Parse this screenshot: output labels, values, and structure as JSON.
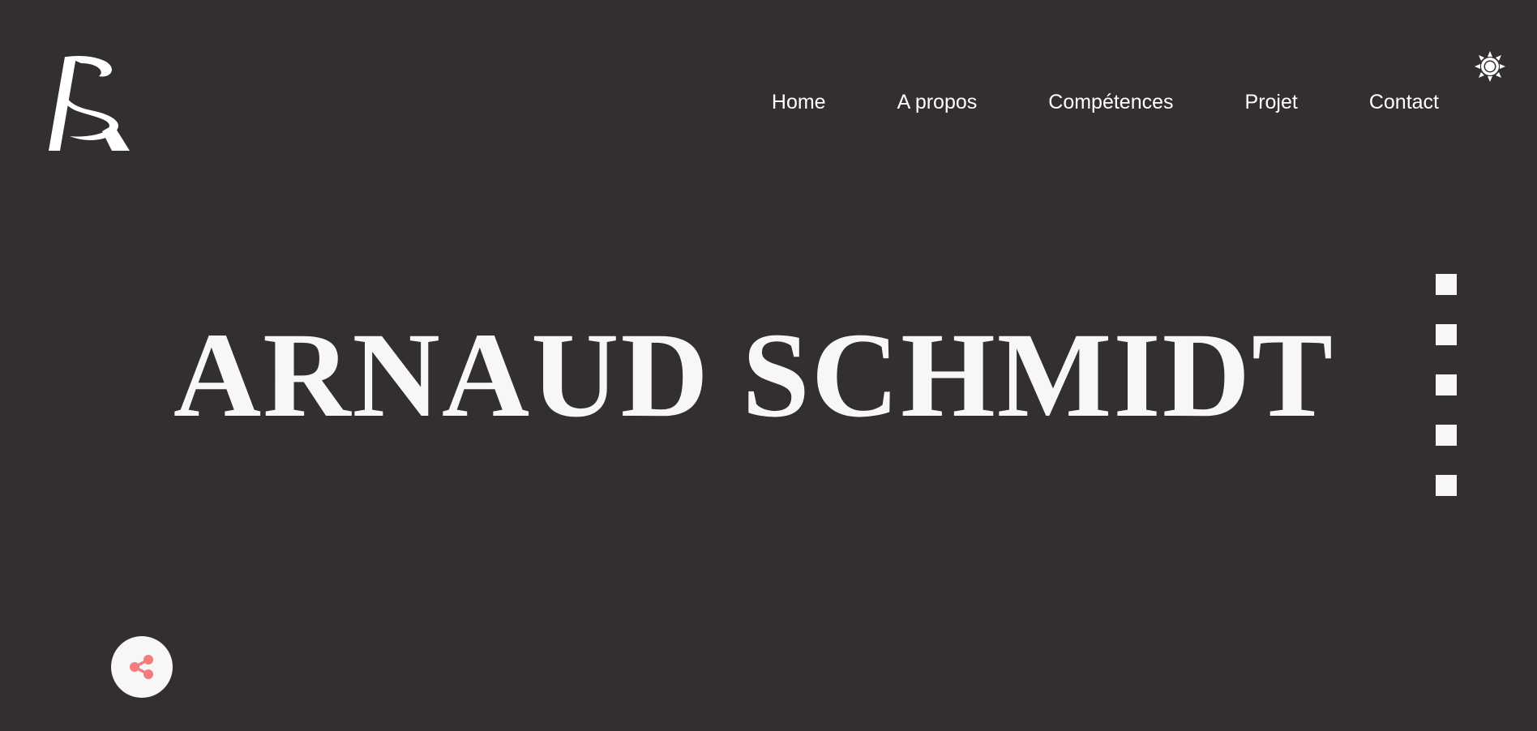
{
  "header": {
    "logo": {
      "icon": "logo-as-monogram",
      "text": "AS"
    },
    "nav": [
      {
        "label": "Home"
      },
      {
        "label": "A propos"
      },
      {
        "label": "Compétences"
      },
      {
        "label": "Projet"
      },
      {
        "label": "Contact"
      }
    ],
    "theme_toggle": {
      "icon": "sun-icon"
    }
  },
  "hero": {
    "title": "ARNAUD SCHMIDT"
  },
  "section_nav": {
    "dot_count": 5,
    "active_index": 0
  },
  "share": {
    "icon": "share-icon"
  },
  "colors": {
    "background": "#332f2e",
    "text": "#ffffff",
    "accent": "#f47c7c",
    "light": "#f7f7f7"
  }
}
